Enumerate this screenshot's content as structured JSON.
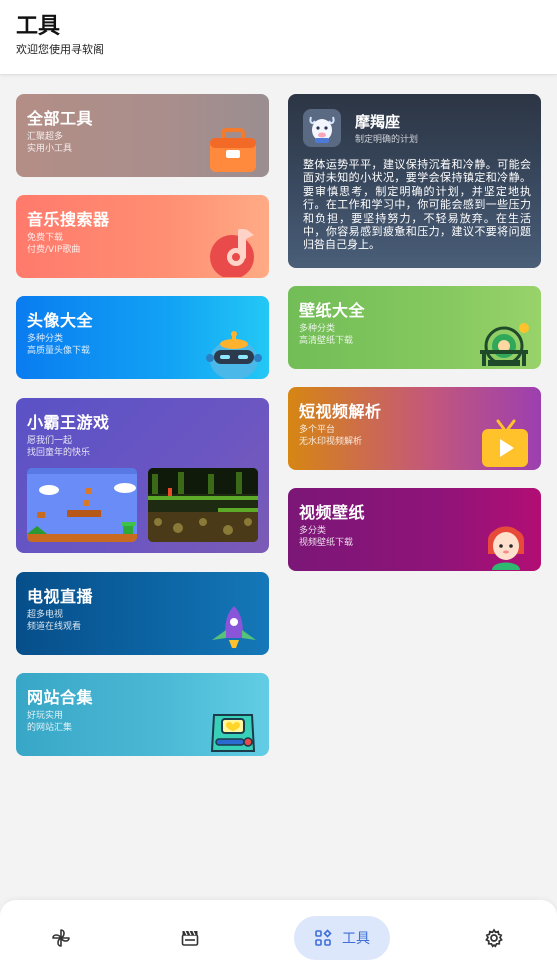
{
  "header": {
    "title": "工具",
    "subtitle": "欢迎您使用寻软阁"
  },
  "left_cards": [
    {
      "title": "全部工具",
      "line1": "汇聚超多",
      "line2": "实用小工具",
      "icon": "toolbox-icon"
    },
    {
      "title": "音乐搜索器",
      "line1": "免费下载",
      "line2": "付费/VIP歌曲",
      "icon": "music-note-icon"
    },
    {
      "title": "头像大全",
      "line1": "多种分类",
      "line2": "高质量头像下载",
      "icon": "robot-avatar-icon"
    },
    {
      "title": "小霸王游戏",
      "line1": "愿我们一起",
      "line2": "找回童年的快乐",
      "icon": "game-screenshots"
    },
    {
      "title": "电视直播",
      "line1": "超多电视",
      "line2": "频道在线观看",
      "icon": "rocket-icon"
    },
    {
      "title": "网站合集",
      "line1": "好玩实用",
      "line2": "的网站汇集",
      "icon": "website-box-icon"
    }
  ],
  "horoscope": {
    "name": "摩羯座",
    "subtitle": "制定明确的计划",
    "icon": "capricorn-icon",
    "text": "整体运势平平，建议保持沉着和冷静。可能会面对未知的小状况，要学会保持镇定和冷静。要审慎思考，制定明确的计划，并坚定地执行。在工作和学习中，你可能会感到一些压力和负担，要坚持努力，不轻易放弃。在生活中，你容易感到疲惫和压力，建议不要将问题归咎自己身上。"
  },
  "right_cards": [
    {
      "title": "壁纸大全",
      "line1": "多种分类",
      "line2": "高清壁纸下载",
      "icon": "ferris-wheel-icon"
    },
    {
      "title": "短视频解析",
      "line1": "多个平台",
      "line2": "无水印视频解析",
      "icon": "tv-play-icon"
    },
    {
      "title": "视频壁纸",
      "line1": "多分类",
      "line2": "视频壁纸下载",
      "icon": "girl-avatar-icon"
    }
  ],
  "tabbar": {
    "items": [
      {
        "name": "pinwheel-icon",
        "label": ""
      },
      {
        "name": "clapperboard-icon",
        "label": ""
      },
      {
        "name": "tools-icon",
        "label": "工具"
      },
      {
        "name": "gear-icon",
        "label": ""
      }
    ],
    "active_index": 2,
    "active_color": "#3f6fd9"
  }
}
